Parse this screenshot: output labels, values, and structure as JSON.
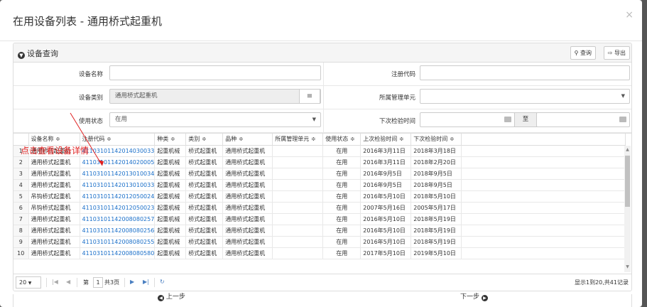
{
  "modal": {
    "title": "在用设备列表 - 通用桥式起重机",
    "close": "×"
  },
  "panel": {
    "title": "设备查询",
    "query_label": "查询",
    "export_label": "导出"
  },
  "form": {
    "device_name_label": "设备名称",
    "device_name_value": "",
    "reg_code_label": "注册代码",
    "reg_code_value": "",
    "category_label": "设备类别",
    "category_value": "通用桥式起重机",
    "unit_label": "所属管理单元",
    "unit_value": "",
    "status_label": "使用状态",
    "status_value": "在用",
    "next_inspect_label": "下次检验时间",
    "to_label": "至"
  },
  "annotation": "点击查看设备详情",
  "table": {
    "headers": [
      "",
      "设备名称 ≑",
      "注册代码 ≑",
      "种类 ≑",
      "类别 ≑",
      "品种 ≑",
      "所属管理单元 ≑",
      "使用状态 ≑",
      "上次检验时间 ≑",
      "下次检验时间 ≑"
    ],
    "rows": [
      [
        "1",
        "通用桥式起重机",
        "41103101142014030033",
        "起重机械",
        "桥式起重机",
        "通用桥式起重机",
        "",
        "在用",
        "2016年3月11日",
        "2018年3月18日"
      ],
      [
        "2",
        "通用桥式起重机",
        "41103101142014020005",
        "起重机械",
        "桥式起重机",
        "通用桥式起重机",
        "",
        "在用",
        "2016年3月11日",
        "2018年2月20日"
      ],
      [
        "3",
        "通用桥式起重机",
        "41103101142013010034",
        "起重机械",
        "桥式起重机",
        "通用桥式起重机",
        "",
        "在用",
        "2016年9月5日",
        "2018年9月5日"
      ],
      [
        "4",
        "通用桥式起重机",
        "41103101142013010033",
        "起重机械",
        "桥式起重机",
        "通用桥式起重机",
        "",
        "在用",
        "2016年9月5日",
        "2018年9月5日"
      ],
      [
        "5",
        "吊钩桥式起重机",
        "41103101142012050024",
        "起重机械",
        "桥式起重机",
        "通用桥式起重机",
        "",
        "在用",
        "2016年5月10日",
        "2018年5月10日"
      ],
      [
        "6",
        "吊钩桥式起重机",
        "41103101142012050023",
        "起重机械",
        "桥式起重机",
        "通用桥式起重机",
        "",
        "在用",
        "2007年5月16日",
        "2005年5月17日"
      ],
      [
        "7",
        "通用桥式起重机",
        "41103101142008080257",
        "起重机械",
        "桥式起重机",
        "通用桥式起重机",
        "",
        "在用",
        "2016年5月10日",
        "2018年5月19日"
      ],
      [
        "8",
        "通用桥式起重机",
        "41103101142008080256",
        "起重机械",
        "桥式起重机",
        "通用桥式起重机",
        "",
        "在用",
        "2016年5月10日",
        "2018年5月19日"
      ],
      [
        "9",
        "通用桥式起重机",
        "41103101142008080255",
        "起重机械",
        "桥式起重机",
        "通用桥式起重机",
        "",
        "在用",
        "2016年5月10日",
        "2018年5月19日"
      ],
      [
        "10",
        "通用桥式起重机",
        "41103101142008080580",
        "起重机械",
        "桥式起重机",
        "通用桥式起重机",
        "",
        "在用",
        "2017年5月10日",
        "2019年5月10日"
      ]
    ]
  },
  "pager": {
    "page_size": "20",
    "page_prefix": "第",
    "page_value": "1",
    "page_suffix": "共3页",
    "info": "显示1到20,共41记录"
  },
  "nav": {
    "prev": "上一步",
    "next": "下一步"
  }
}
